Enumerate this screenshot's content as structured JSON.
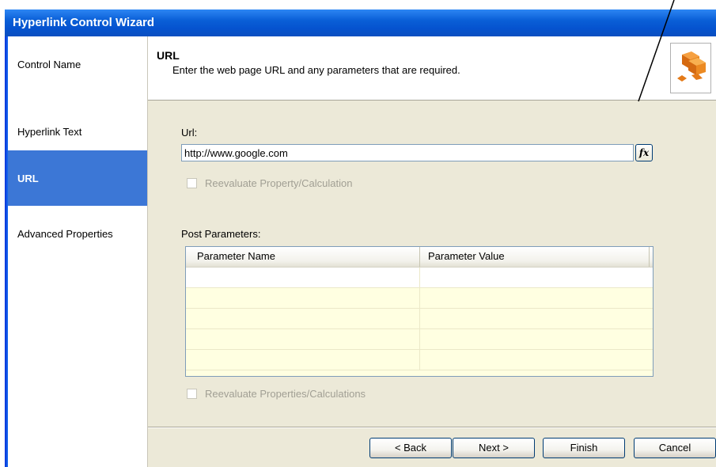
{
  "window": {
    "title": "Hyperlink Control Wizard"
  },
  "sidebar": {
    "items": [
      {
        "label": "Control Name",
        "active": false
      },
      {
        "label": "Hyperlink Text",
        "active": false
      },
      {
        "label": "URL",
        "active": true
      },
      {
        "label": "Advanced Properties",
        "active": false
      }
    ]
  },
  "header": {
    "title": "URL",
    "description": "Enter the web page URL and any parameters that are required.",
    "logo_icon": "orange-cubes-icon"
  },
  "url_field": {
    "label": "Url:",
    "value": "http://www.google.com",
    "formula_button_label": "fx"
  },
  "reevaluate_url": {
    "label": "Reevaluate Property/Calculation",
    "checked": false,
    "enabled": false
  },
  "post_parameters": {
    "label": "Post Parameters:",
    "columns": [
      "Parameter Name",
      "Parameter Value"
    ],
    "rows": [
      [
        "",
        ""
      ],
      [
        "",
        ""
      ],
      [
        "",
        ""
      ],
      [
        "",
        ""
      ],
      [
        "",
        ""
      ]
    ]
  },
  "reevaluate_params": {
    "label": "Reevaluate Properties/Calculations",
    "checked": false,
    "enabled": false
  },
  "buttons": {
    "back": "< Back",
    "next": "Next >",
    "finish": "Finish",
    "cancel": "Cancel"
  },
  "colors": {
    "title_bar": "#0553cf",
    "sidebar_active": "#3c77d6",
    "dialog_bg": "#ece9d8",
    "grid_bg": "#ffffe1"
  }
}
